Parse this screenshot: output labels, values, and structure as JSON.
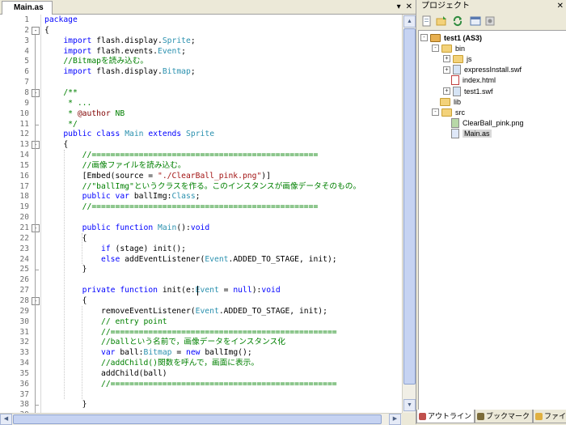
{
  "editor": {
    "tab_label": "Main.as",
    "tab_controls": [
      "▾",
      "✕"
    ],
    "caret_line": 27,
    "lines": [
      [
        {
          "t": "package",
          "c": "kw"
        }
      ],
      [
        {
          "t": "{",
          "c": "pl"
        }
      ],
      [
        {
          "t": "    ",
          "c": "pl"
        },
        {
          "t": "import",
          "c": "kw"
        },
        {
          "t": " flash.display.",
          "c": "pl"
        },
        {
          "t": "Sprite",
          "c": "ty"
        },
        {
          "t": ";",
          "c": "pl"
        }
      ],
      [
        {
          "t": "    ",
          "c": "pl"
        },
        {
          "t": "import",
          "c": "kw"
        },
        {
          "t": " flash.events.",
          "c": "pl"
        },
        {
          "t": "Event",
          "c": "ty"
        },
        {
          "t": ";",
          "c": "pl"
        }
      ],
      [
        {
          "t": "    //Bitmapを読み込む。",
          "c": "cm"
        }
      ],
      [
        {
          "t": "    ",
          "c": "pl"
        },
        {
          "t": "import",
          "c": "kw"
        },
        {
          "t": " flash.display.",
          "c": "pl"
        },
        {
          "t": "Bitmap",
          "c": "ty"
        },
        {
          "t": ";",
          "c": "pl"
        }
      ],
      [],
      [
        {
          "t": "    /**",
          "c": "cm"
        }
      ],
      [
        {
          "t": "     * ...",
          "c": "cm"
        }
      ],
      [
        {
          "t": "     * ",
          "c": "cm"
        },
        {
          "t": "@author",
          "c": "nb"
        },
        {
          "t": " NB",
          "c": "cm"
        }
      ],
      [
        {
          "t": "     */",
          "c": "cm"
        }
      ],
      [
        {
          "t": "    ",
          "c": "pl"
        },
        {
          "t": "public class",
          "c": "kw"
        },
        {
          "t": " ",
          "c": "pl"
        },
        {
          "t": "Main",
          "c": "ty"
        },
        {
          "t": " ",
          "c": "pl"
        },
        {
          "t": "extends",
          "c": "kw"
        },
        {
          "t": " ",
          "c": "pl"
        },
        {
          "t": "Sprite",
          "c": "ty"
        }
      ],
      [
        {
          "t": "    {",
          "c": "pl"
        }
      ],
      [
        {
          "t": "        //================================================",
          "c": "cm"
        }
      ],
      [
        {
          "t": "        //画像ファイルを読み込む。",
          "c": "cm"
        }
      ],
      [
        {
          "t": "        [Embed(source = ",
          "c": "pl"
        },
        {
          "t": "\"./ClearBall_pink.png\"",
          "c": "str"
        },
        {
          "t": ")]",
          "c": "pl"
        }
      ],
      [
        {
          "t": "        //\"ballImg\"というクラスを作る。このインスタンスが画像データそのもの。",
          "c": "cm"
        }
      ],
      [
        {
          "t": "        ",
          "c": "pl"
        },
        {
          "t": "public var",
          "c": "kw"
        },
        {
          "t": " ballImg:",
          "c": "pl"
        },
        {
          "t": "Class",
          "c": "ty"
        },
        {
          "t": ";",
          "c": "pl"
        }
      ],
      [
        {
          "t": "        //================================================",
          "c": "cm"
        }
      ],
      [],
      [
        {
          "t": "        ",
          "c": "pl"
        },
        {
          "t": "public function",
          "c": "kw"
        },
        {
          "t": " ",
          "c": "pl"
        },
        {
          "t": "Main",
          "c": "ty"
        },
        {
          "t": "():",
          "c": "pl"
        },
        {
          "t": "void",
          "c": "kw"
        }
      ],
      [
        {
          "t": "        {",
          "c": "pl"
        }
      ],
      [
        {
          "t": "            ",
          "c": "pl"
        },
        {
          "t": "if",
          "c": "kw"
        },
        {
          "t": " (stage) init();",
          "c": "pl"
        }
      ],
      [
        {
          "t": "            ",
          "c": "pl"
        },
        {
          "t": "else",
          "c": "kw"
        },
        {
          "t": " addEventListener(",
          "c": "pl"
        },
        {
          "t": "Event",
          "c": "ty"
        },
        {
          "t": ".ADDED_TO_STAGE, init);",
          "c": "pl"
        }
      ],
      [
        {
          "t": "        }",
          "c": "pl"
        }
      ],
      [],
      [
        {
          "t": "        ",
          "c": "pl"
        },
        {
          "t": "private function",
          "c": "kw"
        },
        {
          "t": " init(e:",
          "c": "pl"
        },
        {
          "t": "Event",
          "c": "ty"
        },
        {
          "t": " = ",
          "c": "pl"
        },
        {
          "t": "null",
          "c": "kw"
        },
        {
          "t": "):",
          "c": "pl"
        },
        {
          "t": "void",
          "c": "kw"
        }
      ],
      [
        {
          "t": "        {",
          "c": "pl"
        }
      ],
      [
        {
          "t": "            removeEventListener(",
          "c": "pl"
        },
        {
          "t": "Event",
          "c": "ty"
        },
        {
          "t": ".ADDED_TO_STAGE, init);",
          "c": "pl"
        }
      ],
      [
        {
          "t": "            // entry point",
          "c": "cm"
        }
      ],
      [
        {
          "t": "            //================================================",
          "c": "cm"
        }
      ],
      [
        {
          "t": "            //ballという名前で，画像データをインスタンス化",
          "c": "cm"
        }
      ],
      [
        {
          "t": "            ",
          "c": "pl"
        },
        {
          "t": "var",
          "c": "kw"
        },
        {
          "t": " ball:",
          "c": "pl"
        },
        {
          "t": "Bitmap",
          "c": "ty"
        },
        {
          "t": " = ",
          "c": "pl"
        },
        {
          "t": "new",
          "c": "kw"
        },
        {
          "t": " ballImg();",
          "c": "pl"
        }
      ],
      [
        {
          "t": "            //addChild()関数を呼んで，画面に表示。",
          "c": "cm"
        }
      ],
      [
        {
          "t": "            addChild(ball)",
          "c": "pl"
        }
      ],
      [
        {
          "t": "            //================================================",
          "c": "cm"
        }
      ],
      [],
      [
        {
          "t": "        }",
          "c": "pl"
        }
      ],
      []
    ]
  },
  "project": {
    "title": "プロジェクト",
    "close_label": "✕",
    "toolbar": [
      "new-file-icon",
      "add-folder-icon",
      "refresh-icon",
      "properties-icon",
      "settings-icon"
    ],
    "tree": [
      {
        "label": "test1 (AS3)",
        "level": 0,
        "kind": "project",
        "expander": "-",
        "bold": true
      },
      {
        "label": "bin",
        "level": 1,
        "kind": "folder",
        "expander": "-"
      },
      {
        "label": "js",
        "level": 2,
        "kind": "folder",
        "expander": "+"
      },
      {
        "label": "expressInstall.swf",
        "level": 2,
        "kind": "swf",
        "expander": "+"
      },
      {
        "label": "index.html",
        "level": 2,
        "kind": "html",
        "expander": ""
      },
      {
        "label": "test1.swf",
        "level": 2,
        "kind": "swf",
        "expander": "+"
      },
      {
        "label": "lib",
        "level": 1,
        "kind": "folder",
        "expander": ""
      },
      {
        "label": "src",
        "level": 1,
        "kind": "folder",
        "expander": "-"
      },
      {
        "label": "ClearBall_pink.png",
        "level": 2,
        "kind": "image",
        "expander": ""
      },
      {
        "label": "Main.as",
        "level": 2,
        "kind": "as",
        "expander": "",
        "selected": true
      }
    ]
  },
  "bottom_tabs": [
    {
      "label": "アウトライン",
      "icon": "outline-icon",
      "color": "#c0504d"
    },
    {
      "label": "ブックマーク",
      "icon": "bookmark-icon",
      "color": "#7b6b3a"
    },
    {
      "label": "ファイル",
      "icon": "files-icon",
      "color": "#e0b040"
    }
  ],
  "colors": {
    "keyword": "#0000ff",
    "comment": "#008000",
    "type": "#2b91af",
    "string": "#a31515",
    "selection": "#d8d8d8"
  }
}
